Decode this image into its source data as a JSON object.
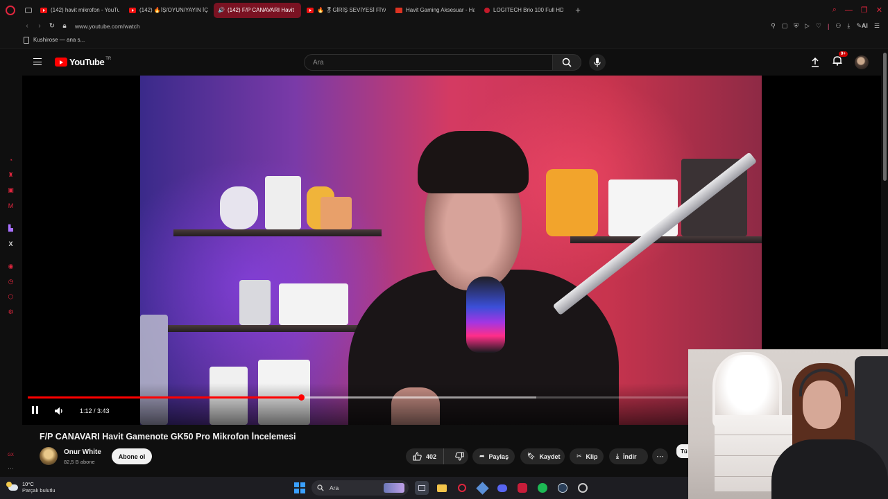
{
  "browser": {
    "tabs": [
      {
        "title": "(142) havit mikrofon - YouTube",
        "icon": "youtube-favicon",
        "active": false
      },
      {
        "title": "(142) 🔥İŞ/OYUN/YAYIN İÇİN",
        "icon": "youtube-favicon",
        "active": false
      },
      {
        "title": "(142) F/P CANAVARI Havit",
        "icon": "youtube-favicon",
        "active": true
      },
      {
        "title": "🔥 🎖GİRİŞ SEVİYESİ FİYAT",
        "icon": "youtube-favicon",
        "active": false
      },
      {
        "title": "Havit Gaming Aksesuar - Havit",
        "icon": "havit-favicon",
        "active": false
      },
      {
        "title": "LOGITECH Brio 100 Full HD",
        "icon": "logitech-favicon",
        "active": false
      }
    ],
    "url": "www.youtube.com/watch",
    "bookmark": "Kushirose — ana s...",
    "addr_right_label": "AI",
    "accent": "#e0263e"
  },
  "youtube": {
    "logo_text": "YouTube",
    "country_code": "TR",
    "search_placeholder": "Ara",
    "notifications_badge": "9+"
  },
  "player": {
    "time": "1:12 / 3:43",
    "progress_played": 0.323,
    "progress_buffered": 0.6,
    "state": "playing"
  },
  "video": {
    "title": "F/P CANAVARI Havit Gamenote GK50 Pro Mikrofon İncelemesi",
    "channel": "Onur White",
    "subscribers": "82,5 B abone",
    "subscribe_label": "Abone ol",
    "likes": "402",
    "share_label": "Paylaş",
    "save_label": "Kaydet",
    "clip_label": "Klip",
    "download_label": "İndir",
    "side_chip_label": "Tü"
  },
  "taskbar": {
    "temperature": "10°C",
    "condition": "Parçalı bulutlu",
    "search_label": "Ara"
  }
}
